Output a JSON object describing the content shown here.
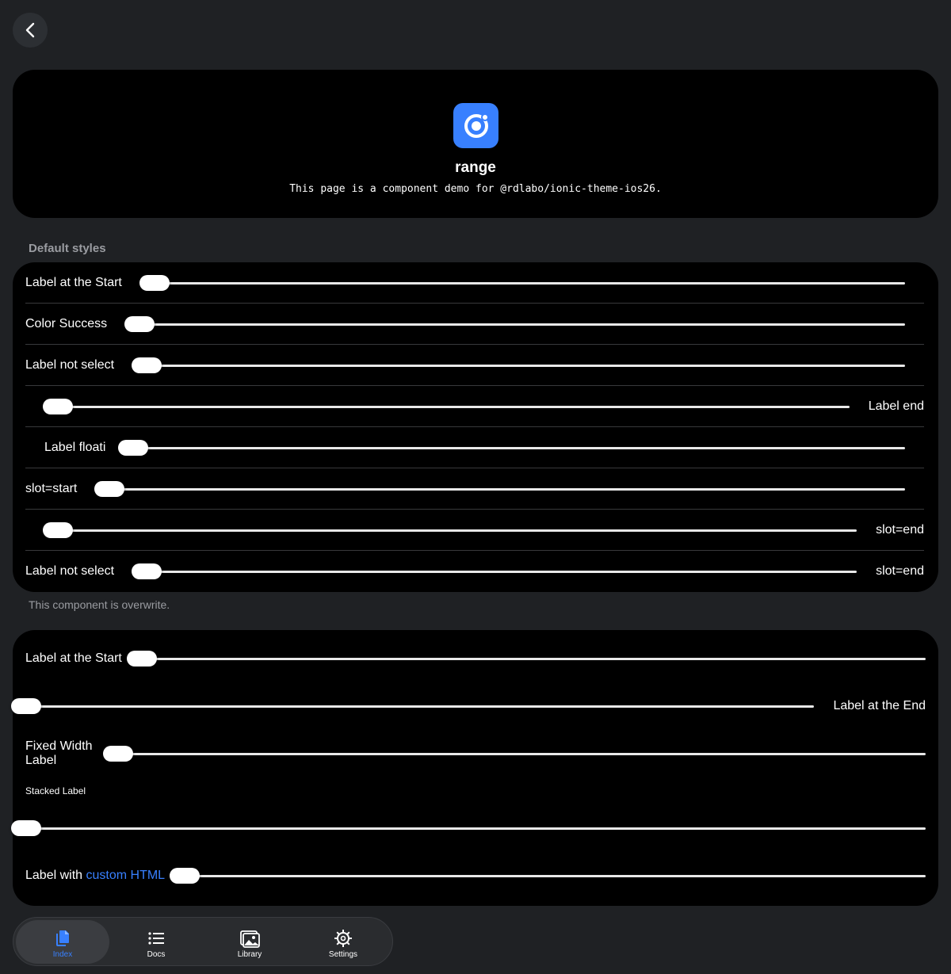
{
  "header": {
    "back_icon": "chevron-left-icon"
  },
  "hero": {
    "logo_icon": "ionic-logo-icon",
    "title": "range",
    "subtitle": "This page is a component demo for @rdlabo/ionic-theme-ios26."
  },
  "section1": {
    "header": "Default styles",
    "rows": [
      {
        "label": "Label at the Start"
      },
      {
        "label": "Color Success"
      },
      {
        "label": "Label not select"
      },
      {
        "label": "Label end"
      },
      {
        "label": "Label floati"
      },
      {
        "label": "slot=start"
      },
      {
        "label": "slot=end"
      },
      {
        "label_start": "Label not select",
        "label_end": "slot=end"
      }
    ],
    "note": "This component is overwrite."
  },
  "section2": {
    "rows": [
      {
        "label": "Label at the Start"
      },
      {
        "label": "Label at the End"
      },
      {
        "label": "Fixed Width Label"
      },
      {
        "label": "Stacked Label"
      },
      {
        "label_prefix": "Label with ",
        "label_link": "custom HTML"
      }
    ]
  },
  "tabbar": {
    "tabs": [
      {
        "label": "Index",
        "icon": "documents-icon",
        "active": true
      },
      {
        "label": "Docs",
        "icon": "list-icon",
        "active": false
      },
      {
        "label": "Library",
        "icon": "images-icon",
        "active": false
      },
      {
        "label": "Settings",
        "icon": "gear-icon",
        "active": false
      }
    ]
  },
  "colors": {
    "accent": "#3880ff",
    "card": "#000000",
    "background": "#1f2124"
  }
}
